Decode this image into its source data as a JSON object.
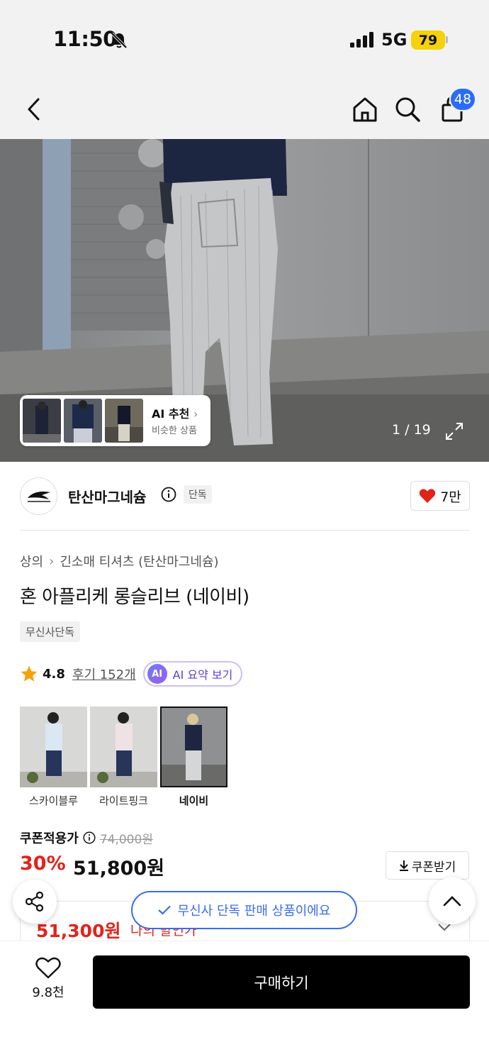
{
  "status_bar": {
    "time": "11:50",
    "network": "5G",
    "battery": "79",
    "battery_color": "#f5d20a",
    "icons": [
      "bell-off-icon",
      "signal-icon"
    ]
  },
  "nav": {
    "back_icon": "chevron-left-icon",
    "home_icon": "home-icon",
    "search_icon": "search-icon",
    "cart_icon": "shopping-bag-icon",
    "cart_count": "48",
    "badge_color": "#2b6cf6"
  },
  "gallery": {
    "ai_recommend_title": "AI 추천",
    "ai_recommend_sub": "비슷한 상품",
    "counter": "1 / 19",
    "expand_icon": "expand-icon"
  },
  "brand": {
    "name": "탄산마그네슘",
    "exclusive_chip": "단독",
    "likes": "7만",
    "info_icon": "info-icon",
    "heart_color": "#e2231a"
  },
  "product": {
    "breadcrumb": [
      "상의",
      "긴소매 티셔츠 (탄산마그네슘)"
    ],
    "title": "혼 아플리케 롱슬리브 (네이비)",
    "tag": "무신사단독",
    "rating": "4.8",
    "review_label": "후기 152개",
    "ai_badge": "AI",
    "ai_summary_label": "AI 요약 보기"
  },
  "colors": [
    {
      "label": "스카이블루",
      "selected": false
    },
    {
      "label": "라이트핑크",
      "selected": false
    },
    {
      "label": "네이비",
      "selected": true
    }
  ],
  "price": {
    "coupon_label": "쿠폰적용가",
    "original": "74,000원",
    "discount": "30%",
    "sale": "51,800원",
    "coupon_button": "쿠폰받기",
    "member_price": "51,300원",
    "member_text": "나의 할인가",
    "accent_color": "#e2231a"
  },
  "toast": {
    "text": "무신사 단독 판매 상품이에요",
    "check_icon": "check-icon",
    "color": "#3a6cf0"
  },
  "floating": {
    "share_icon": "share-icon",
    "top_icon": "chevron-up-icon"
  },
  "bottom": {
    "wish_count": "9.8천",
    "buy_label": "구매하기"
  }
}
